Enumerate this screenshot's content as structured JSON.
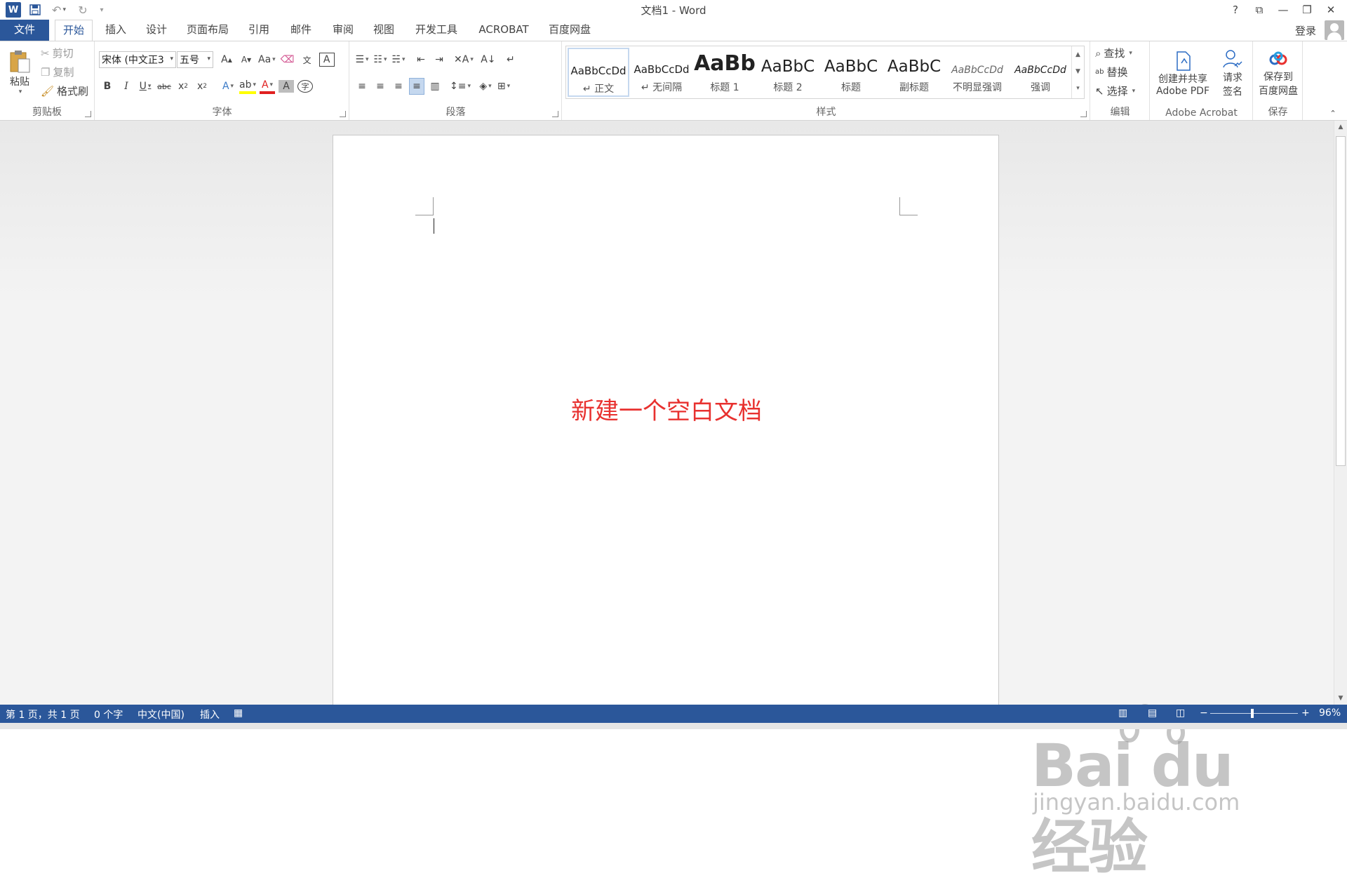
{
  "app": {
    "title": "文档1 - Word",
    "logo_letter": "W",
    "login": "登录",
    "window_controls": [
      "?",
      "⧉",
      "—",
      "❐",
      "✕"
    ]
  },
  "tabs": [
    {
      "label": "文件"
    },
    {
      "label": "开始"
    },
    {
      "label": "插入"
    },
    {
      "label": "设计"
    },
    {
      "label": "页面布局"
    },
    {
      "label": "引用"
    },
    {
      "label": "邮件"
    },
    {
      "label": "审阅"
    },
    {
      "label": "视图"
    },
    {
      "label": "开发工具"
    },
    {
      "label": "ACROBAT"
    },
    {
      "label": "百度网盘"
    }
  ],
  "clipboard": {
    "group": "剪贴板",
    "paste": "粘贴",
    "cut": "剪切",
    "copy": "复制",
    "format_painter": "格式刷"
  },
  "font": {
    "group": "字体",
    "font_name": "宋体 (中文正3",
    "font_size": "五号",
    "change_case": "Aa"
  },
  "paragraph": {
    "group": "段落"
  },
  "styles": {
    "group": "样式",
    "items": [
      {
        "sample": "AaBbCcDd",
        "name": "↵ 正文"
      },
      {
        "sample": "AaBbCcDd",
        "name": "↵ 无间隔"
      },
      {
        "sample": "AaBb",
        "name": "标题 1"
      },
      {
        "sample": "AaBbC",
        "name": "标题 2"
      },
      {
        "sample": "AaBbC",
        "name": "标题"
      },
      {
        "sample": "AaBbC",
        "name": "副标题"
      },
      {
        "sample": "AaBbCcDd",
        "name": "不明显强调"
      },
      {
        "sample": "AaBbCcDd",
        "name": "强调"
      }
    ]
  },
  "editing": {
    "group": "编辑",
    "find": "查找",
    "replace": "替换",
    "select": "选择"
  },
  "acrobat": {
    "group": "Adobe Acrobat",
    "create_line1": "创建并共享",
    "create_line2": "Adobe PDF",
    "sign_line1": "请求",
    "sign_line2": "签名"
  },
  "save": {
    "group": "保存",
    "line1": "保存到",
    "line2": "百度网盘"
  },
  "document": {
    "annotation": "新建一个空白文档"
  },
  "status": {
    "page": "第 1 页，共 1 页",
    "words": "0 个字",
    "language": "中文(中国)",
    "mode": "插入",
    "zoom": "96%",
    "zoom_fraction": 0.48
  },
  "watermark": {
    "brand": "Bai du 经验",
    "url": "jingyan.baidu.com"
  },
  "colors": {
    "brand": "#2b579a",
    "annotation": "#e8312f"
  }
}
